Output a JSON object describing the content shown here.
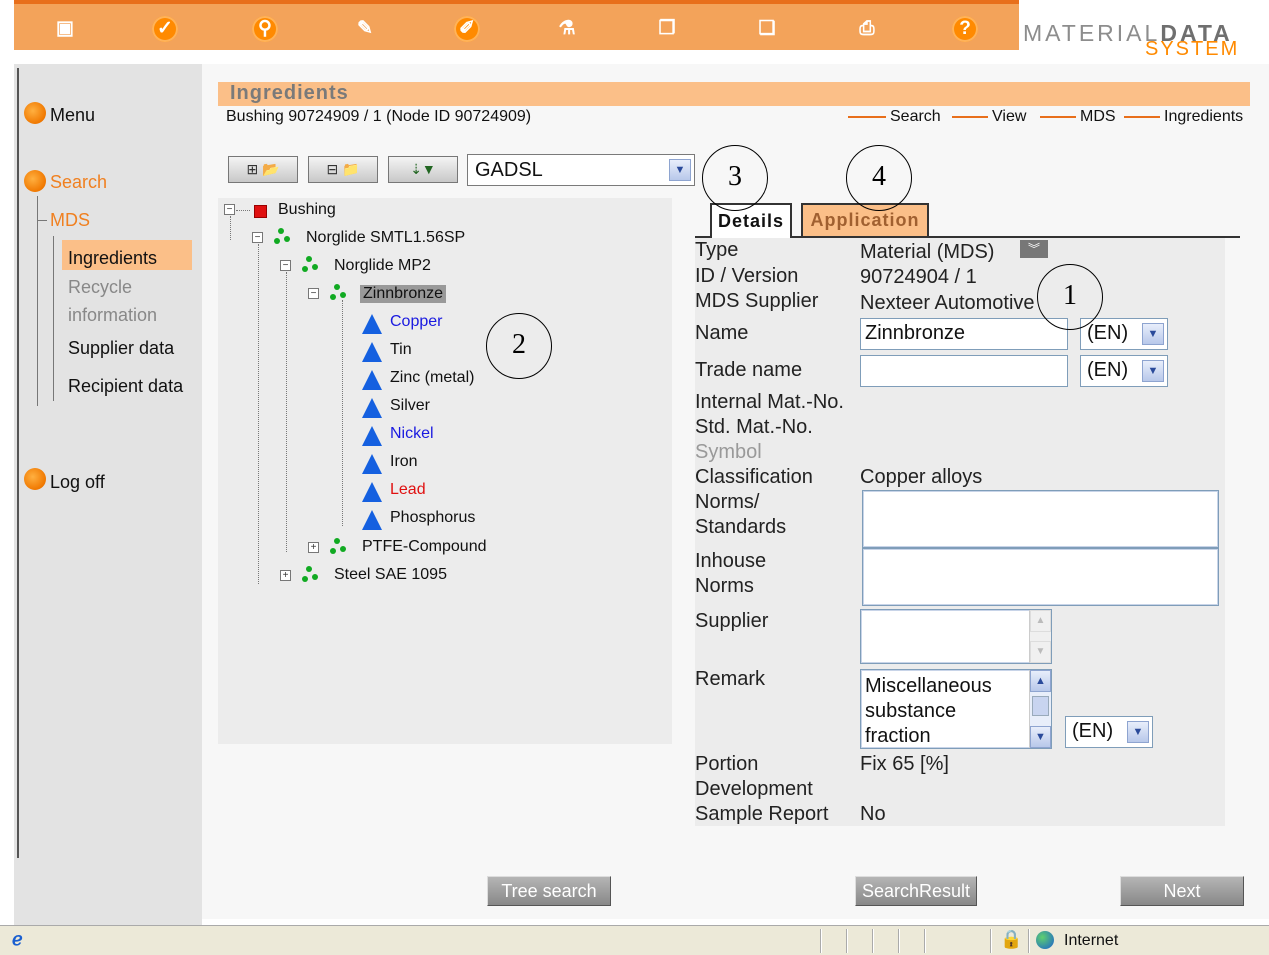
{
  "toolbar": {
    "icons": [
      "save-icon",
      "check-icon",
      "search-icon",
      "note-icon",
      "edit-icon",
      "lab-icon",
      "copy-icon",
      "paste-icon",
      "print-icon",
      "help-icon"
    ]
  },
  "logo": {
    "word1": "MATERIAL",
    "word2": "DATA",
    "word3": "SYSTEM"
  },
  "sidebar": {
    "menu": "Menu",
    "search": "Search",
    "mds": "MDS",
    "ingredients": "Ingredients",
    "recycle1": "Recycle",
    "recycle2": "information",
    "supplier_data": "Supplier data",
    "recipient_data": "Recipient data",
    "logoff": "Log off"
  },
  "header": {
    "title": "Ingredients",
    "subtitle": "Bushing 90724909 / 1 (Node ID 90724909)",
    "breadcrumb": [
      "Search",
      "View",
      "MDS",
      "Ingredients"
    ]
  },
  "treebar": {
    "dropdown": "GADSL"
  },
  "tree": {
    "root": "Bushing",
    "n1": "Norglide SMTL1.56SP",
    "n2": "Norglide MP2",
    "n3": "Zinnbronze",
    "leaves": [
      "Copper",
      "Tin",
      "Zinc (metal)",
      "Silver",
      "Nickel",
      "Iron",
      "Lead",
      "Phosphorus"
    ],
    "ptfe": "PTFE-Compound",
    "steel": "Steel SAE 1095"
  },
  "tabs": {
    "details": "Details",
    "application": "Application"
  },
  "details": {
    "type_label": "Type",
    "type_value": "Material (MDS)",
    "id_label": "ID / Version",
    "id_value": "90724904 / 1",
    "supplier_label": "MDS Supplier",
    "supplier_value": "Nexteer Automotive",
    "name_label": "Name",
    "name_value": "Zinnbronze",
    "name_lang": "(EN)",
    "trade_label": "Trade name",
    "trade_value": "",
    "trade_lang": "(EN)",
    "internal_label": "Internal Mat.-No.",
    "std_label": "Std. Mat.-No.",
    "symbol_label": "Symbol",
    "class_label": "Classification",
    "class_value": "Copper alloys",
    "norms_label1": "Norms/",
    "norms_label2": "Standards",
    "inhouse_label1": "Inhouse",
    "inhouse_label2": "Norms",
    "supplier2_label": "Supplier",
    "remark_label": "Remark",
    "remark_l1": "Miscellaneous",
    "remark_l2": "substance",
    "remark_l3": "fraction",
    "remark_lang": "(EN)",
    "portion_label": "Portion",
    "portion_value": "Fix 65 [%]",
    "dev_label": "Development",
    "sample_label": "Sample Report",
    "sample_value": "No"
  },
  "callouts": {
    "c1": "1",
    "c2": "2",
    "c3": "3",
    "c4": "4"
  },
  "buttons": {
    "tree_search": "Tree search",
    "search_result": "SearchResult",
    "next": "Next"
  },
  "status": {
    "zone": "Internet"
  }
}
